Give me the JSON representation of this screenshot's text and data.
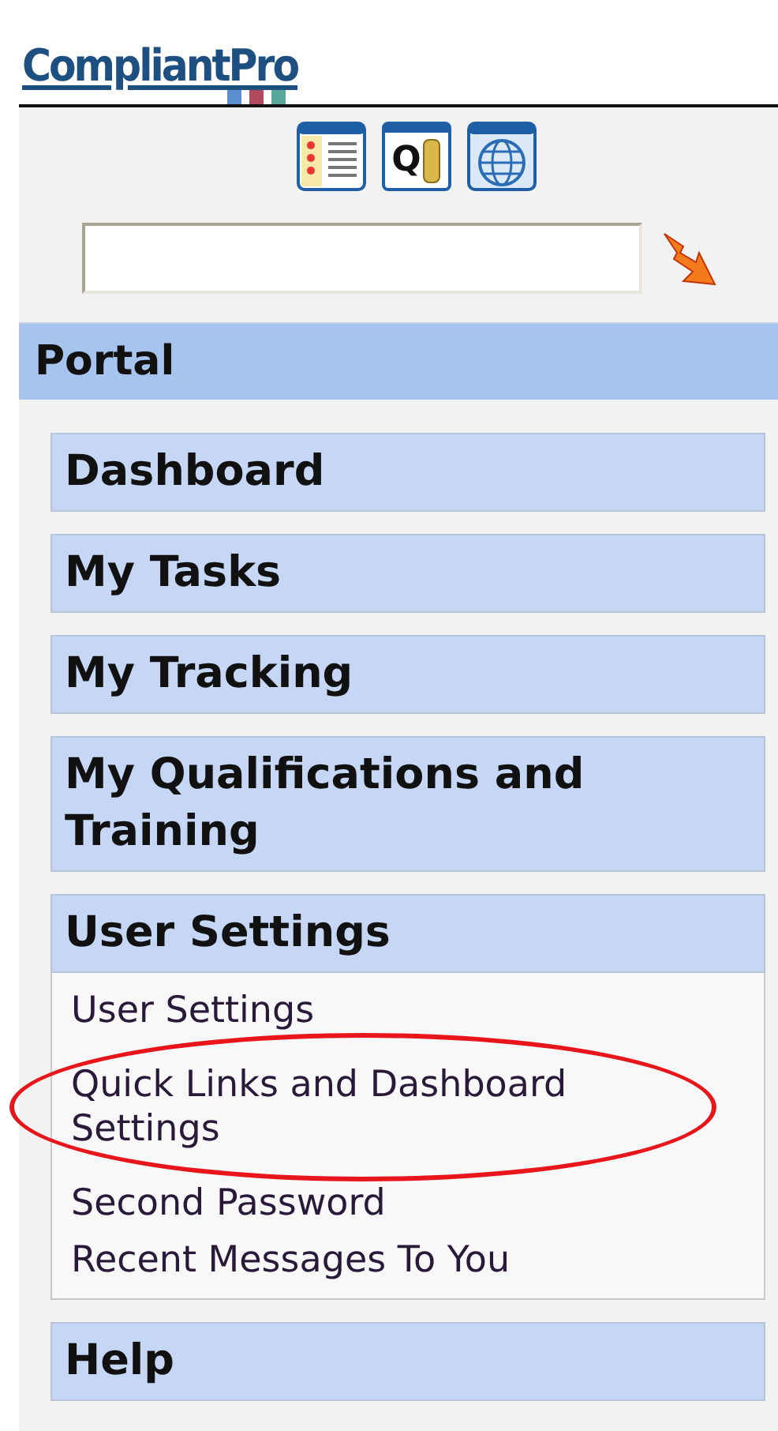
{
  "logo": {
    "text": "CompliantPro"
  },
  "toolbar": [
    {
      "kind": "list"
    },
    {
      "kind": "query",
      "glyph": "Q"
    },
    {
      "kind": "globe"
    }
  ],
  "portal": {
    "title": "Portal"
  },
  "sections": [
    {
      "title": "Dashboard"
    },
    {
      "title": "My Tasks"
    },
    {
      "title": "My Tracking"
    },
    {
      "title": "My Qualifications and Training"
    },
    {
      "title": "User Settings",
      "items": [
        {
          "label": "User Settings",
          "highlighted": false
        },
        {
          "label": "Quick Links and Dashboard Settings",
          "highlighted": true
        },
        {
          "label": "Second Password",
          "highlighted": false
        },
        {
          "label": "Recent Messages To You",
          "highlighted": false
        }
      ]
    },
    {
      "title": "Help"
    }
  ]
}
